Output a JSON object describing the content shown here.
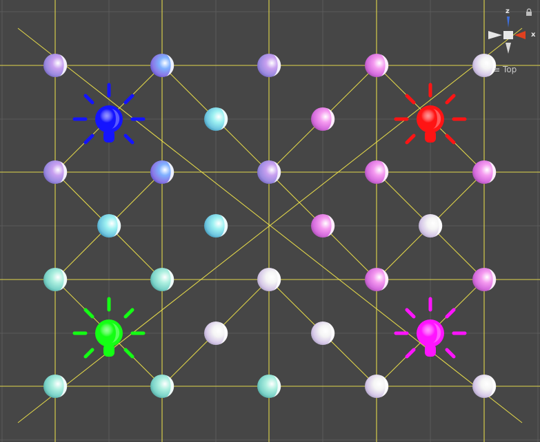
{
  "gizmo": {
    "axis_z": "z",
    "axis_x": "x",
    "view_label": "Top",
    "view_menu_icon": "hamburger-icon",
    "lock_icon": "lock-icon"
  },
  "scene": {
    "background": "#464646",
    "grid_color": "#5b5b5b",
    "wire_color": "#f2e64a",
    "lights": [
      {
        "name": "blue-point-light",
        "color": "#1414ff"
      },
      {
        "name": "red-point-light",
        "color": "#ff1414"
      },
      {
        "name": "green-point-light",
        "color": "#14ff14"
      },
      {
        "name": "magenta-point-light",
        "color": "#ff14ff"
      }
    ]
  }
}
